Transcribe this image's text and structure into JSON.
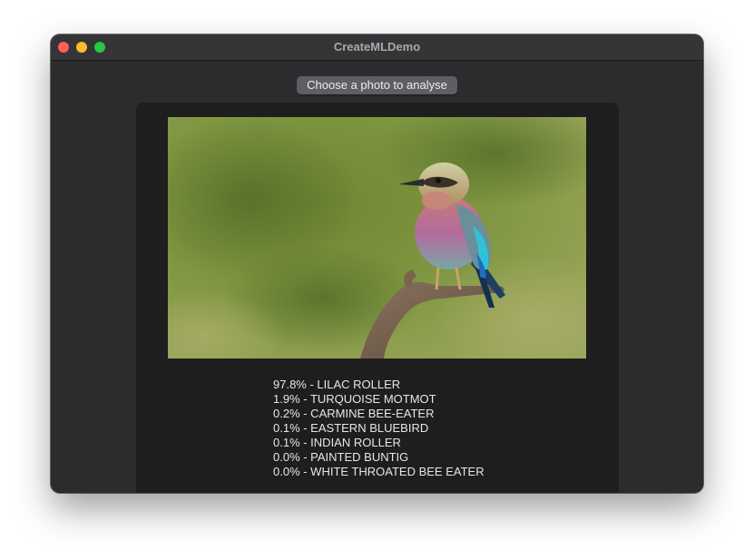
{
  "window": {
    "title": "CreateMLDemo"
  },
  "toolbar": {
    "choose_label": "Choose a photo to analyse"
  },
  "image": {
    "description_icon": "bird-photo"
  },
  "results": [
    {
      "percent": "97.8%",
      "label": "LILAC ROLLER",
      "text": "97.8% - LILAC ROLLER"
    },
    {
      "percent": "1.9%",
      "label": "TURQUOISE MOTMOT",
      "text": "1.9% - TURQUOISE MOTMOT"
    },
    {
      "percent": "0.2%",
      "label": "CARMINE BEE-EATER",
      "text": "0.2% - CARMINE BEE-EATER"
    },
    {
      "percent": "0.1%",
      "label": "EASTERN BLUEBIRD",
      "text": "0.1% - EASTERN BLUEBIRD"
    },
    {
      "percent": "0.1%",
      "label": "INDIAN ROLLER",
      "text": "0.1% - INDIAN ROLLER"
    },
    {
      "percent": "0.0%",
      "label": "PAINTED BUNTIG",
      "text": "0.0% - PAINTED BUNTIG"
    },
    {
      "percent": "0.0%",
      "label": "WHITE THROATED BEE EATER",
      "text": "0.0% - WHITE THROATED BEE EATER"
    }
  ],
  "colors": {
    "window_bg": "#2c2b2e",
    "panel_bg": "#1e1e1e",
    "button_bg": "#5f5e62",
    "close": "#fe5f57",
    "minimize": "#febc2e",
    "maximize": "#28c840"
  }
}
